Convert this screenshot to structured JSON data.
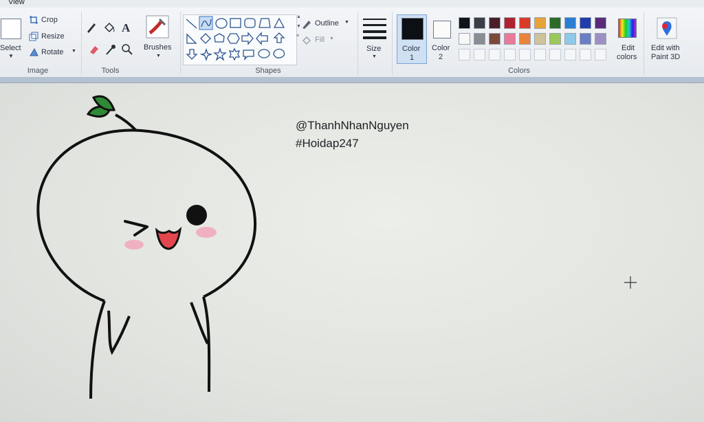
{
  "menubar": {
    "view": "View"
  },
  "image_group": {
    "label": "Image",
    "select": "Select",
    "crop": "Crop",
    "resize": "Resize",
    "rotate": "Rotate"
  },
  "tools_group": {
    "label": "Tools"
  },
  "brushes": {
    "label": "Brushes"
  },
  "shapes_group": {
    "label": "Shapes",
    "outline": "Outline",
    "fill": "Fill"
  },
  "size": {
    "label": "Size"
  },
  "color1": {
    "label_line1": "Color",
    "label_line2": "1"
  },
  "color2": {
    "label_line1": "Color",
    "label_line2": "2"
  },
  "colors_group": {
    "label": "Colors",
    "palette_row1": [
      "#101317",
      "#3a3f46",
      "#4a1f27",
      "#b0222f",
      "#d93a2a",
      "#e8a23a",
      "#2e6b2a",
      "#2a7fd4",
      "#213ea8",
      "#5a2a78"
    ],
    "palette_row2": [
      "#f7f7f5",
      "#8a8d91",
      "#7a4a3a",
      "#e97a9a",
      "#e9843a",
      "#cfc39a",
      "#9ac85a",
      "#8fc9e8",
      "#6d7fc4",
      "#9d8fc4"
    ]
  },
  "edit_colors": {
    "line1": "Edit",
    "line2": "colors"
  },
  "edit_paint3d": {
    "line1": "Edit with",
    "line2": "Paint 3D"
  },
  "canvas": {
    "text_line1": "@ThanhNhanNguyen",
    "text_line2": "#Hoidap247"
  }
}
